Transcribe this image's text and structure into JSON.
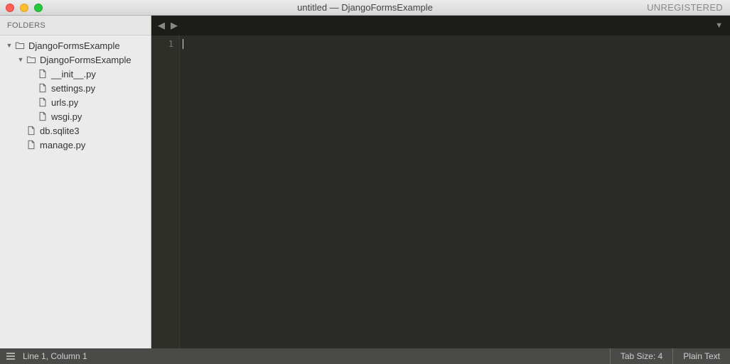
{
  "titlebar": {
    "title": "untitled — DjangoFormsExample",
    "right": "UNREGISTERED"
  },
  "sidebar": {
    "header": "FOLDERS",
    "tree": [
      {
        "depth": 0,
        "kind": "folder",
        "expanded": true,
        "label": "DjangoFormsExample"
      },
      {
        "depth": 1,
        "kind": "folder",
        "expanded": true,
        "label": "DjangoFormsExample"
      },
      {
        "depth": 2,
        "kind": "file",
        "label": "__init__.py"
      },
      {
        "depth": 2,
        "kind": "file",
        "label": "settings.py"
      },
      {
        "depth": 2,
        "kind": "file",
        "label": "urls.py"
      },
      {
        "depth": 2,
        "kind": "file",
        "label": "wsgi.py"
      },
      {
        "depth": 1,
        "kind": "file",
        "label": "db.sqlite3"
      },
      {
        "depth": 1,
        "kind": "file",
        "label": "manage.py"
      }
    ]
  },
  "editor": {
    "gutter_lines": [
      "1"
    ]
  },
  "statusbar": {
    "position": "Line 1, Column 1",
    "tabsize": "Tab Size: 4",
    "syntax": "Plain Text"
  }
}
